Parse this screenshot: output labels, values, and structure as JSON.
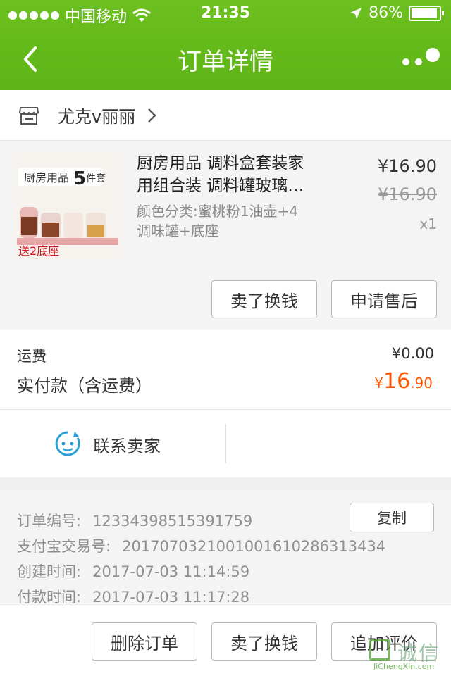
{
  "status_bar": {
    "carrier": "中国移动",
    "time": "21:35",
    "battery": "86%",
    "battery_level": 0.86
  },
  "nav": {
    "title": "订单详情",
    "back_icon": "chevron-left-icon",
    "more_icon": "more-dots-icon"
  },
  "shop": {
    "name": "尤克v丽丽",
    "icon": "store-icon"
  },
  "product": {
    "title_line1": "厨房用品 调料盒套装家",
    "title_line2": "用组合装 调料罐玻璃…",
    "spec_line1": "颜色分类:蜜桃粉1油壶+4",
    "spec_line2": "调味罐+底座",
    "price": "¥16.90",
    "original_price": "¥16.90",
    "quantity": "x1",
    "image_text_top_a": "厨房用品",
    "image_text_top_b": "5",
    "image_text_top_c": "件套",
    "image_text_bottom": "送2底座"
  },
  "actions": {
    "sell": "卖了换钱",
    "after_sale": "申请售后"
  },
  "fees": {
    "shipping_label": "运费",
    "shipping_value": "¥0.00",
    "paid_label": "实付款（含运费）",
    "paid_currency": "¥",
    "paid_int": "16",
    "paid_dec": ".90"
  },
  "contact": {
    "label": "联系卖家",
    "icon": "chat-face-icon"
  },
  "order_info": {
    "order_no_label": "订单编号:",
    "order_no": "12334398515391759",
    "copy": "复制",
    "alipay_label": "支付宝交易号:",
    "alipay_no": "2017070321001001610286313434",
    "created_label": "创建时间:",
    "created": "2017-07-03 11:14:59",
    "paid_label": "付款时间:",
    "paid": "2017-07-03 11:17:28"
  },
  "bottom_bar": {
    "delete": "删除订单",
    "sell": "卖了换钱",
    "review": "追加评价"
  },
  "watermark": {
    "cn": "诚信",
    "en": "JiChengXin.com"
  },
  "colors": {
    "header_green": "#62b81a",
    "paid_orange": "#ff5500"
  }
}
